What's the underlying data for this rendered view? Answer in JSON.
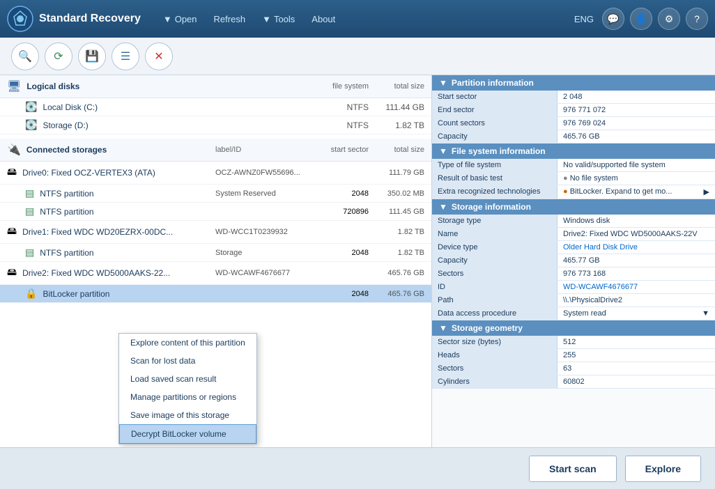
{
  "app": {
    "title": "Standard Recovery",
    "language": "ENG"
  },
  "nav": {
    "open_label": "Open",
    "refresh_label": "Refresh",
    "tools_label": "Tools",
    "about_label": "About"
  },
  "toolbar": {
    "search_icon": "🔍",
    "scan_icon": "⚙",
    "save_icon": "💾",
    "list_icon": "☰",
    "close_icon": "✕"
  },
  "logical_disks": {
    "header": "Logical disks",
    "col_filesystem": "file system",
    "col_total_size": "total size",
    "items": [
      {
        "name": "Local Disk (C:)",
        "filesystem": "NTFS",
        "size": "111.44 GB"
      },
      {
        "name": "Storage (D:)",
        "filesystem": "NTFS",
        "size": "1.82 TB"
      }
    ]
  },
  "connected_storages": {
    "header": "Connected storages",
    "col_label": "label/ID",
    "col_start_sector": "start sector",
    "col_total_size": "total size",
    "items": [
      {
        "name": "Drive0: Fixed OCZ-VERTEX3 (ATA)",
        "label": "OCZ-AWNZ0FW55696...",
        "start_sector": "",
        "size": "111.79 GB",
        "type": "drive"
      },
      {
        "name": "NTFS partition",
        "label": "System Reserved",
        "start_sector": "2048",
        "size": "350.02 MB",
        "type": "partition"
      },
      {
        "name": "NTFS partition",
        "label": "",
        "start_sector": "720896",
        "size": "111.45 GB",
        "type": "partition"
      },
      {
        "name": "Drive1: Fixed WDC WD20EZRX-00DC...",
        "label": "WD-WCC1T0239932",
        "start_sector": "",
        "size": "1.82 TB",
        "type": "drive"
      },
      {
        "name": "NTFS partition",
        "label": "Storage",
        "start_sector": "2048",
        "size": "1.82 TB",
        "type": "partition"
      },
      {
        "name": "Drive2: Fixed WDC WD5000AAKS-22...",
        "label": "WD-WCAWF4676677",
        "start_sector": "",
        "size": "465.76 GB",
        "type": "drive"
      },
      {
        "name": "BitLocker partition",
        "label": "",
        "start_sector": "2048",
        "size": "465.76 GB",
        "type": "partition",
        "selected": true
      }
    ]
  },
  "context_menu": {
    "items": [
      {
        "label": "Explore content of this partition",
        "active": false
      },
      {
        "label": "Scan for lost data",
        "active": false
      },
      {
        "label": "Load saved scan result",
        "active": false
      },
      {
        "label": "Manage partitions or regions",
        "active": false
      },
      {
        "label": "Save image of this storage",
        "active": false
      },
      {
        "label": "Decrypt BitLocker volume",
        "active": true
      }
    ]
  },
  "partition_info": {
    "header": "Partition information",
    "fields": [
      {
        "label": "Start sector",
        "value": "2 048"
      },
      {
        "label": "End sector",
        "value": "976 771 072"
      },
      {
        "label": "Count sectors",
        "value": "976 769 024"
      },
      {
        "label": "Capacity",
        "value": "465.76 GB"
      }
    ]
  },
  "filesystem_info": {
    "header": "File system information",
    "fields": [
      {
        "label": "Type of file system",
        "value": "No valid/supported file system",
        "style": ""
      },
      {
        "label": "Result of basic test",
        "value": "No file system",
        "style": "gray-dot"
      },
      {
        "label": "Extra recognized technologies",
        "value": "BitLocker. Expand to get mo...",
        "style": "orange-dot",
        "has_arrow": true
      }
    ]
  },
  "storage_info": {
    "header": "Storage information",
    "fields": [
      {
        "label": "Storage type",
        "value": "Windows disk"
      },
      {
        "label": "Name",
        "value": "Drive2: Fixed WDC WD5000AAKS-22V"
      },
      {
        "label": "Device type",
        "value": "Older Hard Disk Drive",
        "style": "link"
      },
      {
        "label": "Capacity",
        "value": "465.77 GB"
      },
      {
        "label": "Sectors",
        "value": "976 773 168"
      },
      {
        "label": "ID",
        "value": "WD-WCAWF4676677",
        "style": "link"
      },
      {
        "label": "Path",
        "value": "\\\\.\\PhysicalDrive2"
      },
      {
        "label": "Data access procedure",
        "value": "System read",
        "has_dropdown": true
      }
    ]
  },
  "storage_geometry": {
    "header": "Storage geometry",
    "fields": [
      {
        "label": "Sector size (bytes)",
        "value": "512"
      },
      {
        "label": "Heads",
        "value": "255"
      },
      {
        "label": "Sectors",
        "value": "63"
      },
      {
        "label": "Cylinders",
        "value": "60802"
      }
    ]
  },
  "footer": {
    "start_scan_label": "Start scan",
    "explore_label": "Explore"
  }
}
